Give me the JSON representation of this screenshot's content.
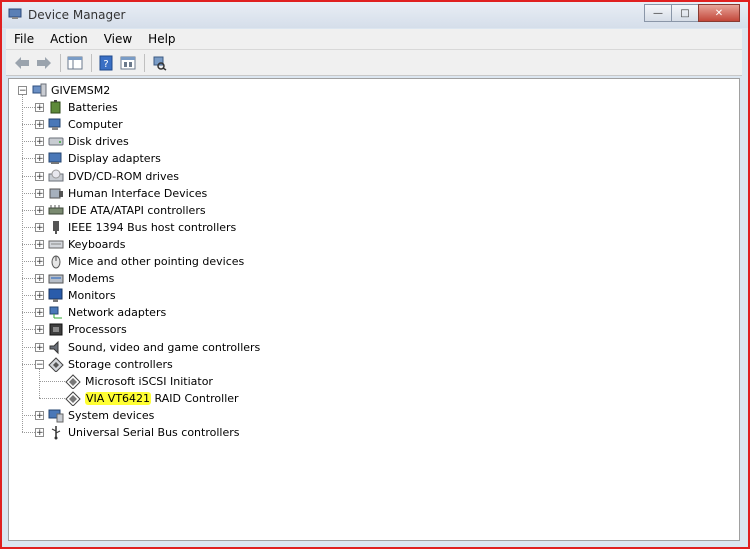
{
  "window": {
    "title": "Device Manager"
  },
  "menu": [
    "File",
    "Action",
    "View",
    "Help"
  ],
  "tree": {
    "root": "GIVEMSM2",
    "categories": [
      {
        "label": "Batteries",
        "icon": "battery-icon"
      },
      {
        "label": "Computer",
        "icon": "computer-icon"
      },
      {
        "label": "Disk drives",
        "icon": "disk-drive-icon"
      },
      {
        "label": "Display adapters",
        "icon": "display-adapter-icon"
      },
      {
        "label": "DVD/CD-ROM drives",
        "icon": "dvd-drive-icon"
      },
      {
        "label": "Human Interface Devices",
        "icon": "hid-icon"
      },
      {
        "label": "IDE ATA/ATAPI controllers",
        "icon": "ide-controller-icon"
      },
      {
        "label": "IEEE 1394 Bus host controllers",
        "icon": "firewire-icon"
      },
      {
        "label": "Keyboards",
        "icon": "keyboard-icon"
      },
      {
        "label": "Mice and other pointing devices",
        "icon": "mouse-icon"
      },
      {
        "label": "Modems",
        "icon": "modem-icon"
      },
      {
        "label": "Monitors",
        "icon": "monitor-icon"
      },
      {
        "label": "Network adapters",
        "icon": "network-adapter-icon"
      },
      {
        "label": "Processors",
        "icon": "processor-icon"
      },
      {
        "label": "Sound, video and game controllers",
        "icon": "sound-icon"
      },
      {
        "label": "Storage controllers",
        "icon": "storage-controller-icon",
        "expanded": true,
        "children": [
          {
            "label": "Microsoft iSCSI Initiator"
          },
          {
            "label_highlight": "VIA VT6421",
            "label_rest": " RAID Controller"
          }
        ]
      },
      {
        "label": "System devices",
        "icon": "system-devices-icon"
      },
      {
        "label": "Universal Serial Bus controllers",
        "icon": "usb-icon"
      }
    ]
  },
  "colors": {
    "highlight": "#ffff33",
    "frame": "#e02020"
  }
}
